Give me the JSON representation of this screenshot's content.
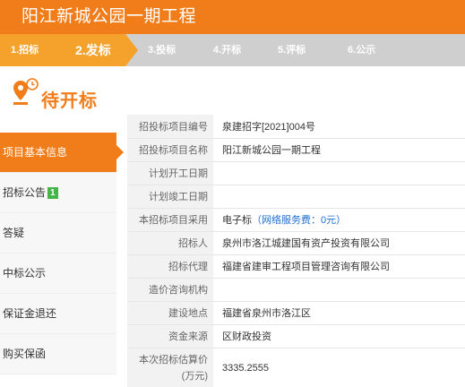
{
  "header": {
    "title": "阳江新城公园一期工程"
  },
  "steps": [
    {
      "label": "1.招标",
      "state": "done"
    },
    {
      "label": "2.发标",
      "state": "active"
    },
    {
      "label": "3.投标",
      "state": "pending"
    },
    {
      "label": "4.开标",
      "state": "pending"
    },
    {
      "label": "5.评标",
      "state": "pending"
    },
    {
      "label": "6.公示",
      "state": "pending"
    }
  ],
  "status": {
    "title": "待开标",
    "icon": "pin-clock-icon"
  },
  "sidebar": {
    "items": [
      {
        "label": "项目基本信息",
        "active": true
      },
      {
        "label": "招标公告",
        "badge": "1"
      },
      {
        "label": "答疑"
      },
      {
        "label": "中标公示"
      },
      {
        "label": "保证金退还"
      },
      {
        "label": "购买保函"
      }
    ]
  },
  "info": {
    "rows": [
      {
        "key": "招投标项目编号",
        "value": "泉建招字[2021]004号"
      },
      {
        "key": "招投标项目名称",
        "value": "阳江新城公园一期工程"
      },
      {
        "key": "计划开工日期",
        "value": ""
      },
      {
        "key": "计划竣工日期",
        "value": ""
      },
      {
        "key": "本招标项目采用",
        "value": "电子标",
        "value_link": "（网络服务费：0元）"
      },
      {
        "key": "招标人",
        "value": "泉州市洛江城建国有资产投资有限公司"
      },
      {
        "key": "招标代理",
        "value": "福建省建审工程项目管理咨询有限公司"
      },
      {
        "key": "造价咨询机构",
        "value": ""
      },
      {
        "key": "建设地点",
        "value": "福建省泉州市洛江区"
      },
      {
        "key": "资金来源",
        "value": "区财政投资"
      },
      {
        "key_line1": "本次招标估算价",
        "key_line2": "(万元)",
        "value": "3335.2555"
      }
    ]
  },
  "colors": {
    "brand": "#f07d1a",
    "step_done": "#f5a22d",
    "step_pending": "#cfcfcf",
    "badge": "#44b549",
    "link": "#1f6fd1"
  }
}
